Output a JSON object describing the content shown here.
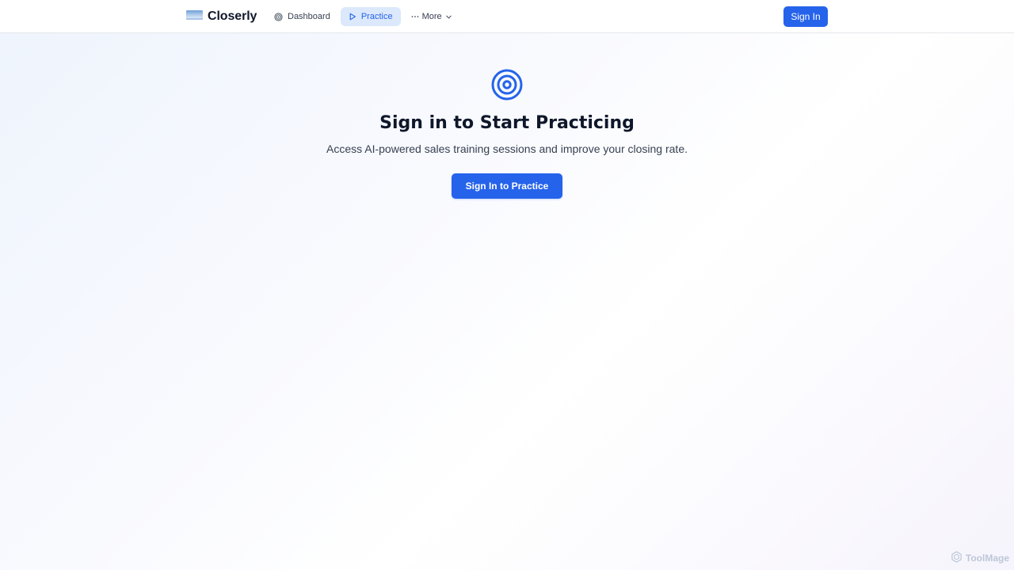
{
  "header": {
    "brand_name": "Closerly",
    "nav": [
      {
        "label": "Dashboard",
        "icon": "target-icon",
        "active": false
      },
      {
        "label": "Practice",
        "icon": "play-icon",
        "active": true
      },
      {
        "label": "More",
        "icon": "ellipsis-icon",
        "active": false
      }
    ],
    "sign_in_label": "Sign In"
  },
  "main": {
    "icon": "target-icon",
    "title": "Sign in to Start Practicing",
    "subtitle": "Access AI-powered sales training sessions and improve your closing rate.",
    "cta_label": "Sign In to Practice"
  },
  "watermark": {
    "text": "ToolMage"
  },
  "colors": {
    "accent": "#2563eb",
    "active_nav_bg": "#dce8fb",
    "text_primary": "#0f172a",
    "text_secondary": "#374151"
  }
}
